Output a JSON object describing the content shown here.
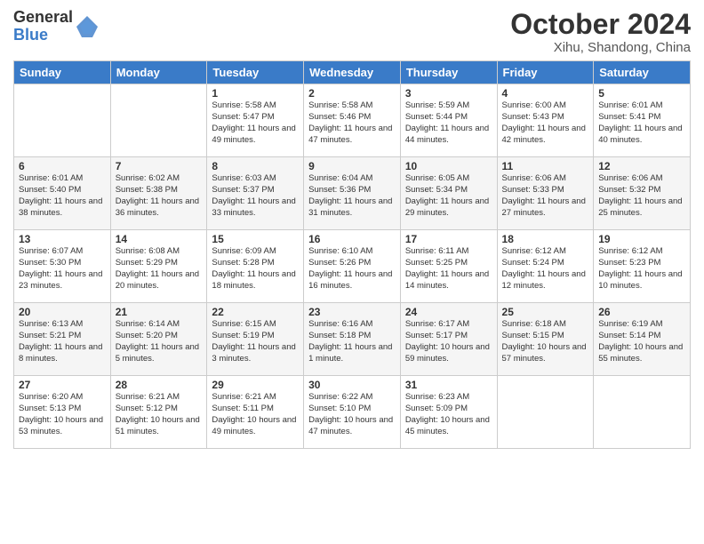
{
  "header": {
    "logo_general": "General",
    "logo_blue": "Blue",
    "month_title": "October 2024",
    "subtitle": "Xihu, Shandong, China"
  },
  "weekdays": [
    "Sunday",
    "Monday",
    "Tuesday",
    "Wednesday",
    "Thursday",
    "Friday",
    "Saturday"
  ],
  "weeks": [
    [
      {
        "day": "",
        "sunrise": "",
        "sunset": "",
        "daylight": ""
      },
      {
        "day": "",
        "sunrise": "",
        "sunset": "",
        "daylight": ""
      },
      {
        "day": "1",
        "sunrise": "Sunrise: 5:58 AM",
        "sunset": "Sunset: 5:47 PM",
        "daylight": "Daylight: 11 hours and 49 minutes."
      },
      {
        "day": "2",
        "sunrise": "Sunrise: 5:58 AM",
        "sunset": "Sunset: 5:46 PM",
        "daylight": "Daylight: 11 hours and 47 minutes."
      },
      {
        "day": "3",
        "sunrise": "Sunrise: 5:59 AM",
        "sunset": "Sunset: 5:44 PM",
        "daylight": "Daylight: 11 hours and 44 minutes."
      },
      {
        "day": "4",
        "sunrise": "Sunrise: 6:00 AM",
        "sunset": "Sunset: 5:43 PM",
        "daylight": "Daylight: 11 hours and 42 minutes."
      },
      {
        "day": "5",
        "sunrise": "Sunrise: 6:01 AM",
        "sunset": "Sunset: 5:41 PM",
        "daylight": "Daylight: 11 hours and 40 minutes."
      }
    ],
    [
      {
        "day": "6",
        "sunrise": "Sunrise: 6:01 AM",
        "sunset": "Sunset: 5:40 PM",
        "daylight": "Daylight: 11 hours and 38 minutes."
      },
      {
        "day": "7",
        "sunrise": "Sunrise: 6:02 AM",
        "sunset": "Sunset: 5:38 PM",
        "daylight": "Daylight: 11 hours and 36 minutes."
      },
      {
        "day": "8",
        "sunrise": "Sunrise: 6:03 AM",
        "sunset": "Sunset: 5:37 PM",
        "daylight": "Daylight: 11 hours and 33 minutes."
      },
      {
        "day": "9",
        "sunrise": "Sunrise: 6:04 AM",
        "sunset": "Sunset: 5:36 PM",
        "daylight": "Daylight: 11 hours and 31 minutes."
      },
      {
        "day": "10",
        "sunrise": "Sunrise: 6:05 AM",
        "sunset": "Sunset: 5:34 PM",
        "daylight": "Daylight: 11 hours and 29 minutes."
      },
      {
        "day": "11",
        "sunrise": "Sunrise: 6:06 AM",
        "sunset": "Sunset: 5:33 PM",
        "daylight": "Daylight: 11 hours and 27 minutes."
      },
      {
        "day": "12",
        "sunrise": "Sunrise: 6:06 AM",
        "sunset": "Sunset: 5:32 PM",
        "daylight": "Daylight: 11 hours and 25 minutes."
      }
    ],
    [
      {
        "day": "13",
        "sunrise": "Sunrise: 6:07 AM",
        "sunset": "Sunset: 5:30 PM",
        "daylight": "Daylight: 11 hours and 23 minutes."
      },
      {
        "day": "14",
        "sunrise": "Sunrise: 6:08 AM",
        "sunset": "Sunset: 5:29 PM",
        "daylight": "Daylight: 11 hours and 20 minutes."
      },
      {
        "day": "15",
        "sunrise": "Sunrise: 6:09 AM",
        "sunset": "Sunset: 5:28 PM",
        "daylight": "Daylight: 11 hours and 18 minutes."
      },
      {
        "day": "16",
        "sunrise": "Sunrise: 6:10 AM",
        "sunset": "Sunset: 5:26 PM",
        "daylight": "Daylight: 11 hours and 16 minutes."
      },
      {
        "day": "17",
        "sunrise": "Sunrise: 6:11 AM",
        "sunset": "Sunset: 5:25 PM",
        "daylight": "Daylight: 11 hours and 14 minutes."
      },
      {
        "day": "18",
        "sunrise": "Sunrise: 6:12 AM",
        "sunset": "Sunset: 5:24 PM",
        "daylight": "Daylight: 11 hours and 12 minutes."
      },
      {
        "day": "19",
        "sunrise": "Sunrise: 6:12 AM",
        "sunset": "Sunset: 5:23 PM",
        "daylight": "Daylight: 11 hours and 10 minutes."
      }
    ],
    [
      {
        "day": "20",
        "sunrise": "Sunrise: 6:13 AM",
        "sunset": "Sunset: 5:21 PM",
        "daylight": "Daylight: 11 hours and 8 minutes."
      },
      {
        "day": "21",
        "sunrise": "Sunrise: 6:14 AM",
        "sunset": "Sunset: 5:20 PM",
        "daylight": "Daylight: 11 hours and 5 minutes."
      },
      {
        "day": "22",
        "sunrise": "Sunrise: 6:15 AM",
        "sunset": "Sunset: 5:19 PM",
        "daylight": "Daylight: 11 hours and 3 minutes."
      },
      {
        "day": "23",
        "sunrise": "Sunrise: 6:16 AM",
        "sunset": "Sunset: 5:18 PM",
        "daylight": "Daylight: 11 hours and 1 minute."
      },
      {
        "day": "24",
        "sunrise": "Sunrise: 6:17 AM",
        "sunset": "Sunset: 5:17 PM",
        "daylight": "Daylight: 10 hours and 59 minutes."
      },
      {
        "day": "25",
        "sunrise": "Sunrise: 6:18 AM",
        "sunset": "Sunset: 5:15 PM",
        "daylight": "Daylight: 10 hours and 57 minutes."
      },
      {
        "day": "26",
        "sunrise": "Sunrise: 6:19 AM",
        "sunset": "Sunset: 5:14 PM",
        "daylight": "Daylight: 10 hours and 55 minutes."
      }
    ],
    [
      {
        "day": "27",
        "sunrise": "Sunrise: 6:20 AM",
        "sunset": "Sunset: 5:13 PM",
        "daylight": "Daylight: 10 hours and 53 minutes."
      },
      {
        "day": "28",
        "sunrise": "Sunrise: 6:21 AM",
        "sunset": "Sunset: 5:12 PM",
        "daylight": "Daylight: 10 hours and 51 minutes."
      },
      {
        "day": "29",
        "sunrise": "Sunrise: 6:21 AM",
        "sunset": "Sunset: 5:11 PM",
        "daylight": "Daylight: 10 hours and 49 minutes."
      },
      {
        "day": "30",
        "sunrise": "Sunrise: 6:22 AM",
        "sunset": "Sunset: 5:10 PM",
        "daylight": "Daylight: 10 hours and 47 minutes."
      },
      {
        "day": "31",
        "sunrise": "Sunrise: 6:23 AM",
        "sunset": "Sunset: 5:09 PM",
        "daylight": "Daylight: 10 hours and 45 minutes."
      },
      {
        "day": "",
        "sunrise": "",
        "sunset": "",
        "daylight": ""
      },
      {
        "day": "",
        "sunrise": "",
        "sunset": "",
        "daylight": ""
      }
    ]
  ]
}
